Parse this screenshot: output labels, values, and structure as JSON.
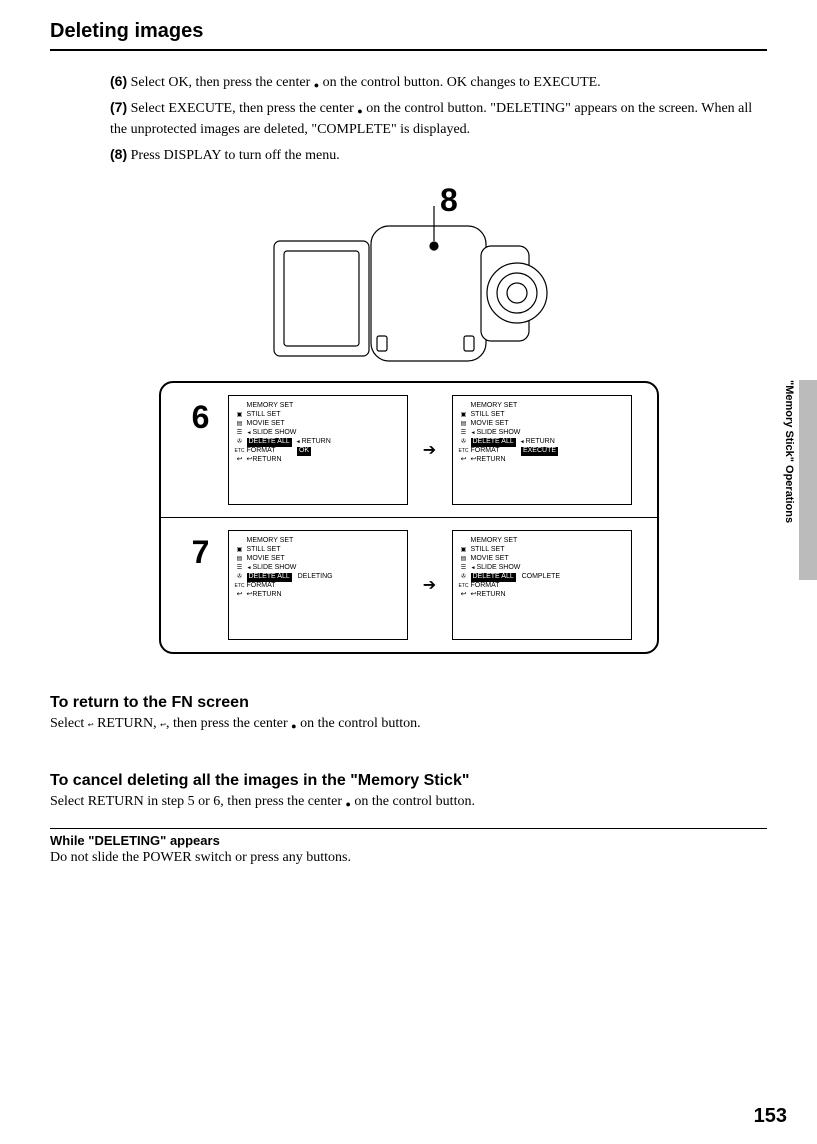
{
  "title": "Deleting images",
  "steps": {
    "s6_num": "(6)",
    "s6_text_a": "Select OK, then press the center ",
    "s6_text_b": " on the control button. OK changes to EXECUTE.",
    "s7_num": "(7)",
    "s7_text_a": "Select EXECUTE, then press the center ",
    "s7_text_b": " on the control button. \"DELETING\" appears on the screen. When all the unprotected images are deleted, \"COMPLETE\" is displayed.",
    "s8_num": "(8)",
    "s8_text": "Press DISPLAY to turn off the menu."
  },
  "callout8": "8",
  "row6": {
    "num": "6",
    "lcd1": {
      "title": "MEMORY SET",
      "items": [
        "STILL SET",
        "MOVIE SET",
        "SLIDE SHOW",
        "DELETE ALL",
        "FORMAT",
        "RETURN"
      ],
      "right1": "RETURN",
      "right2": "OK"
    },
    "lcd2": {
      "title": "MEMORY SET",
      "items": [
        "STILL SET",
        "MOVIE SET",
        "SLIDE SHOW",
        "DELETE ALL",
        "FORMAT",
        "RETURN"
      ],
      "right1": "RETURN",
      "right2": "EXECUTE"
    }
  },
  "row7": {
    "num": "7",
    "lcd1": {
      "title": "MEMORY SET",
      "items": [
        "STILL SET",
        "MOVIE SET",
        "SLIDE SHOW",
        "DELETE ALL",
        "FORMAT",
        "RETURN"
      ],
      "status": "DELETING"
    },
    "lcd2": {
      "title": "MEMORY SET",
      "items": [
        "STILL SET",
        "MOVIE SET",
        "SLIDE SHOW",
        "DELETE ALL",
        "FORMAT",
        "RETURN"
      ],
      "status": "COMPLETE"
    }
  },
  "sub1_heading": "To return to the FN screen",
  "sub1_text_a": "Select ",
  "sub1_text_b": " RETURN, ",
  "sub1_text_c": ", then press the center ",
  "sub1_text_d": " on the control button.",
  "sub2_heading": "To cancel deleting all the images in the \"Memory Stick\"",
  "sub2_text_a": "Select RETURN in step 5 or 6, then press the center ",
  "sub2_text_b": " on the control button.",
  "note_heading": "While \"DELETING\" appears",
  "note_text": "Do not slide the POWER switch or press any buttons.",
  "side_label": "\"Memory Stick\" Operations",
  "page_num": "153"
}
